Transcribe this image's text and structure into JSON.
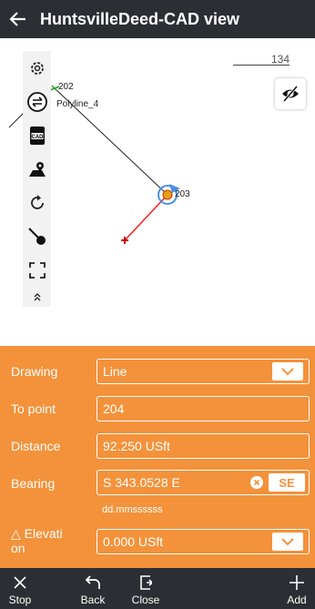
{
  "header": {
    "title": "HuntsvilleDeed-CAD view",
    "back_icon": "back-arrow-icon"
  },
  "map": {
    "scale_label": "134",
    "points": {
      "start": "202",
      "current": "203"
    },
    "polyline_label": "Polyline_4",
    "toolbar_icons": [
      "gear-icon",
      "swap-icon",
      "cad-icon",
      "map-pin-icon",
      "rotate-icon",
      "point-tool-icon",
      "fullscreen-icon",
      "collapse-icon"
    ],
    "colors": {
      "line_new": "#ff1a1a",
      "point_current": "#e6a11a",
      "selection": "#4a90e2"
    }
  },
  "form": {
    "drawing": {
      "label": "Drawing",
      "value": "Line"
    },
    "to_point": {
      "label": "To point",
      "value": "204"
    },
    "distance": {
      "label": "Distance",
      "value": "92.250 USft"
    },
    "bearing": {
      "label": "Bearing",
      "value": "S 343.0528 E",
      "format_hint": "dd.mmssssss",
      "quadrant_button": "SE"
    },
    "elevation": {
      "label_line1": "△ Elevati",
      "label_line2": "on",
      "value": "0.000 USft"
    },
    "accent_color": "#f3923a"
  },
  "bottom_bar": {
    "stop": "Stop",
    "back": "Back",
    "close": "Close",
    "add": "Add"
  }
}
